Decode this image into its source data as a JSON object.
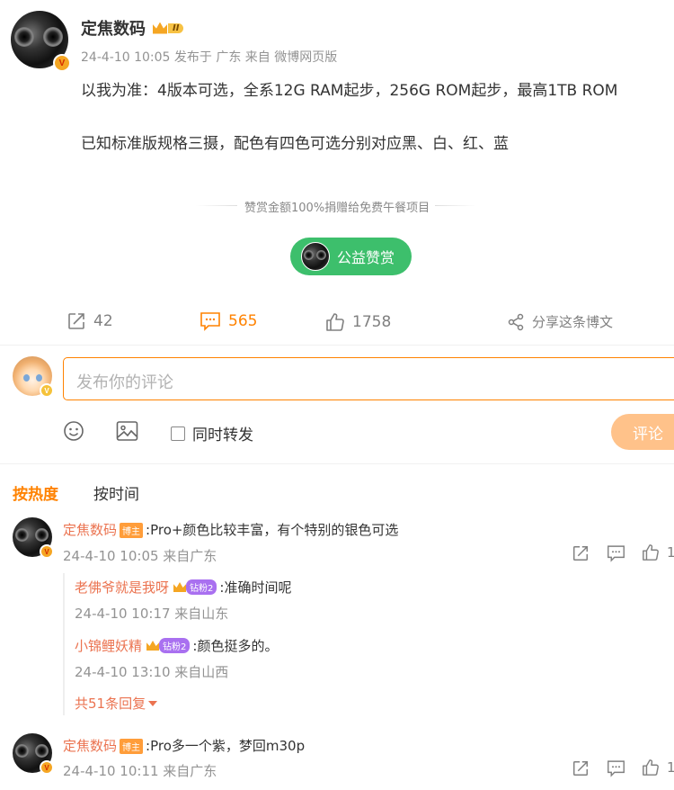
{
  "post": {
    "author": "定焦数码",
    "level_badge": "II",
    "meta": "24-4-10 10:05 发布于 广东 来自 微博网页版",
    "lines": [
      "以我为准：4版本可选，全系12G RAM起步，256G ROM起步，最高1TB ROM",
      "已知标准版规格三摄，配色有四色可选分别对应黑、白、红、蓝"
    ],
    "donation_note": "赞赏金额100%捐赠给免费午餐项目",
    "donate_button": "公益赞赏",
    "repost_count": "42",
    "comment_count": "565",
    "like_count": "1758",
    "share_label": "分享这条博文"
  },
  "composer": {
    "placeholder": "发布你的评论",
    "repost_option": "同时转发",
    "submit_label": "评论"
  },
  "sort": {
    "hot": "按热度",
    "time": "按时间"
  },
  "comments": [
    {
      "author": "定焦数码",
      "badge": "博主",
      "text": ":Pro+颜色比较丰富，有个特别的银色可选",
      "meta": "24-4-10 10:05 来自广东",
      "like_count": "1",
      "replies": [
        {
          "author": "老佛爷就是我呀",
          "fan_badge": "钻粉2",
          "text": ":准确时间呢",
          "meta": "24-4-10 10:17 来自山东"
        },
        {
          "author": "小锦鲤妖精",
          "fan_badge": "钻粉2",
          "text": ":颜色挺多的。",
          "meta": "24-4-10 13:10 来自山西"
        }
      ],
      "more_replies": "共51条回复"
    },
    {
      "author": "定焦数码",
      "badge": "博主",
      "text": ":Pro多一个紫，梦回m30p",
      "meta": "24-4-10 10:11 来自广东",
      "like_count": "1"
    }
  ],
  "colors": {
    "accent": "#ff8200",
    "link": "#eb7350",
    "donate_green": "#3dbf6c",
    "submit_disabled": "#ffc28a"
  }
}
